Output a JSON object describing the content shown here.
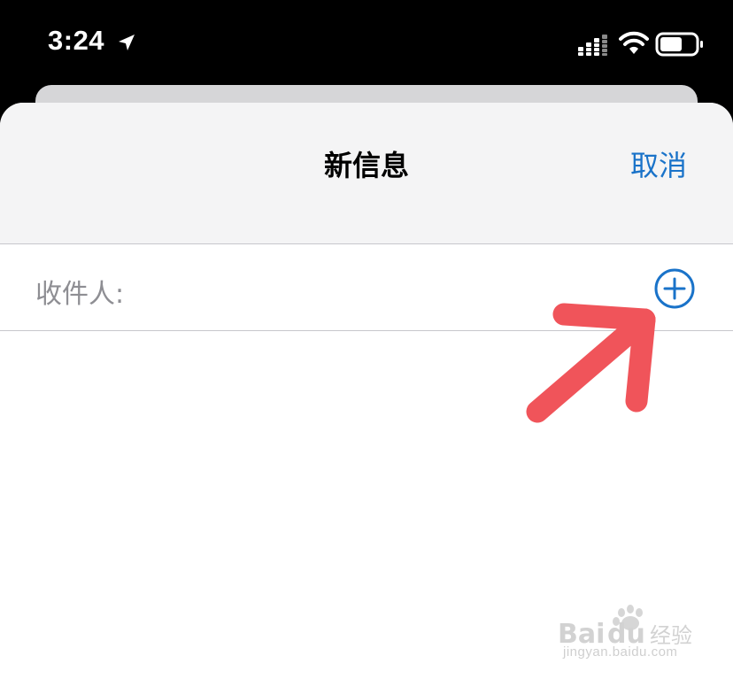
{
  "status_bar": {
    "time": "3:24",
    "icons": [
      "location-arrow-icon",
      "cellular-signal-icon",
      "wifi-icon",
      "battery-icon"
    ]
  },
  "compose_sheet": {
    "title": "新信息",
    "cancel_label": "取消",
    "recipient_label": "收件人:",
    "add_contact_icon": "plus-circle-icon"
  },
  "annotation": {
    "arrow_icon": "red-pointer-arrow",
    "color": "#f0545a"
  },
  "watermark": {
    "brand": "Baidu经验",
    "domain": "jingyan.baidu.com"
  },
  "colors": {
    "accent": "#1a73c9",
    "header_bg": "#f4f4f5",
    "separator": "#c7c7cc",
    "placeholder_text": "#8e8e93"
  }
}
